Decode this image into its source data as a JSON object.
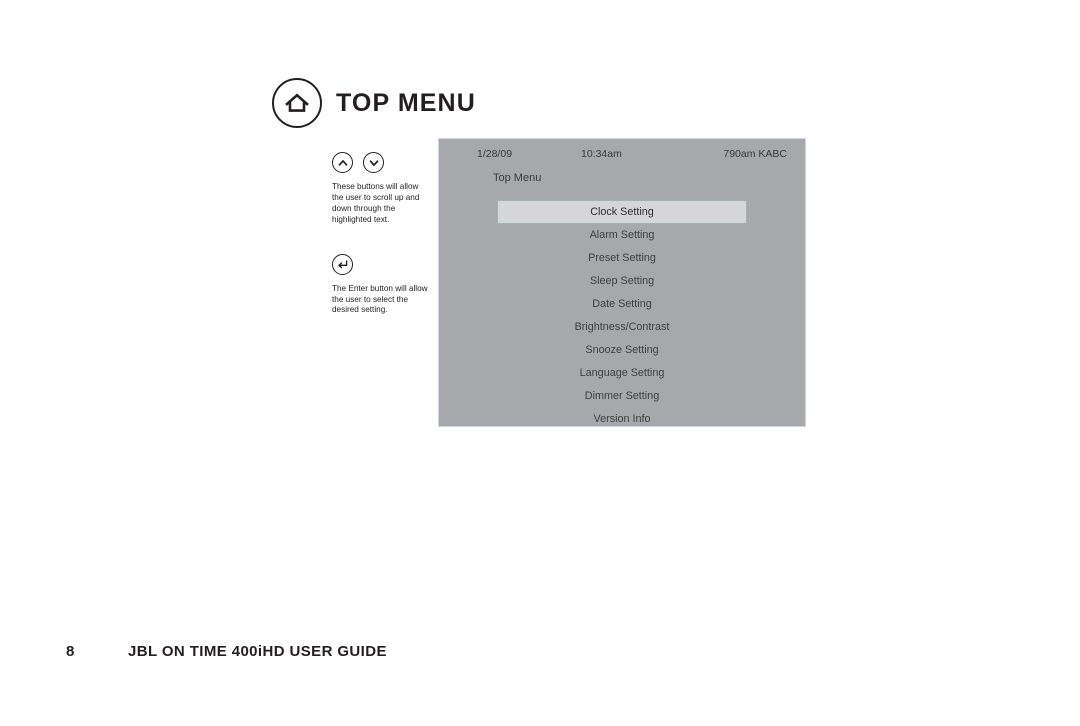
{
  "page": {
    "title": "TOP MENU",
    "home_icon": "home-icon"
  },
  "annotations": {
    "scroll_buttons": {
      "up_icon": "chevron-up-icon",
      "down_icon": "chevron-down-icon",
      "caption": "These buttons will allow the user to scroll up and down through the highlighted text."
    },
    "enter_button": {
      "icon": "enter-return-icon",
      "caption": "The Enter button will allow the user to select the desired setting."
    }
  },
  "lcd": {
    "status": {
      "date": "1/28/09",
      "time": "10:34am",
      "radio_station": "790am KABC"
    },
    "context_label": "Top Menu",
    "selected_index": 0,
    "menu_items": [
      "Clock Setting",
      "Alarm Setting",
      "Preset Setting",
      "Sleep Setting",
      "Date Setting",
      "Brightness/Contrast",
      "Snooze Setting",
      "Language Setting",
      "Dimmer Setting",
      "Version Info"
    ],
    "colors": {
      "screen_background": "#a6a8ab",
      "highlight_background": "#d5d6d8",
      "highlight_border": "#9fb3b3",
      "text": "#3f3f41"
    }
  },
  "footer": {
    "page_number": "8",
    "guide_title": "JBL ON TIME 400iHD USER GUIDE"
  }
}
